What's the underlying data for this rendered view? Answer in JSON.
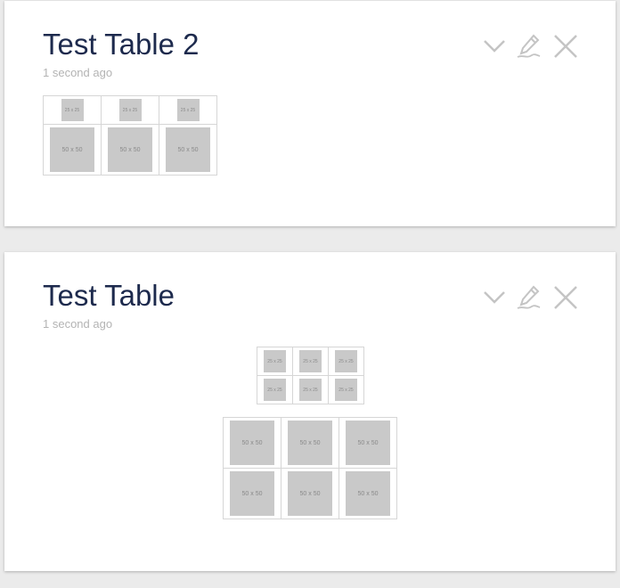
{
  "cards": [
    {
      "title": "Test Table 2",
      "timestamp": "1 second ago",
      "actions": [
        "chevron-down-icon",
        "pencil-icon",
        "close-icon"
      ],
      "tables": [
        {
          "rows": [
            [
              "25 x 25",
              "25 x 25",
              "25 x 25"
            ],
            [
              "50 x 50",
              "50 x 50",
              "50 x 50"
            ]
          ]
        }
      ]
    },
    {
      "title": "Test Table",
      "timestamp": "1 second ago",
      "actions": [
        "chevron-down-icon",
        "pencil-icon",
        "close-icon"
      ],
      "tables": [
        {
          "rows": [
            [
              "25 x 25",
              "25 x 25",
              "25 x 25"
            ],
            [
              "25 x 25",
              "25 x 25",
              "25 x 25"
            ]
          ]
        },
        {
          "rows": [
            [
              "50 x 50",
              "50 x 50",
              "50 x 50"
            ],
            [
              "50 x 50",
              "50 x 50",
              "50 x 50"
            ]
          ]
        }
      ]
    }
  ],
  "colors": {
    "background": "#ebebeb",
    "card": "#ffffff",
    "title": "#1d2a4d",
    "timestamp": "#b3b3b3",
    "icon": "#c4c4c4",
    "placeholder": "#c9c9c9",
    "table_border": "#d6d6d6"
  }
}
